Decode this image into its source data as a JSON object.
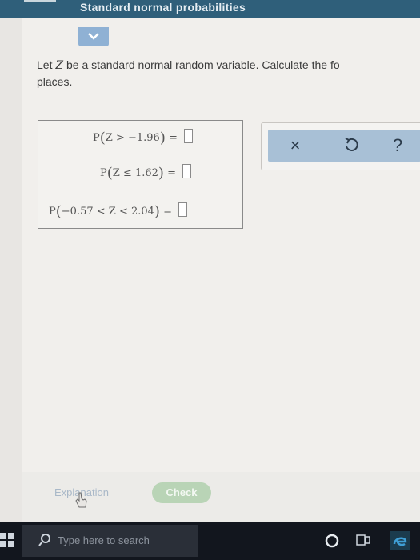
{
  "window": {
    "title": "Standard normal probabilities"
  },
  "question": {
    "prefix": "Let ",
    "var": "Z",
    "mid": " be a ",
    "link_text": "standard normal random variable",
    "suffix": ". Calculate the fo",
    "line2": "places."
  },
  "equations": [
    {
      "lhs_open": "P",
      "expr": "Z > −1.96",
      "eq": "=",
      "answer": ""
    },
    {
      "lhs_open": "P",
      "expr": "Z ≤ 1.62",
      "eq": "=",
      "answer": ""
    },
    {
      "lhs_open": "P",
      "expr": "−0.57 < Z < 2.04",
      "eq": "=",
      "answer": ""
    }
  ],
  "tools": {
    "clear_icon": "×",
    "undo_icon": "undo-icon",
    "help_icon": "?"
  },
  "buttons": {
    "explanation": "Explanation",
    "check": "Check"
  },
  "taskbar": {
    "search_placeholder": "Type here to search"
  },
  "colors": {
    "titlebar": "#2f5f7a",
    "check": "#b9d4b6",
    "tools": "#a8c0d6"
  }
}
